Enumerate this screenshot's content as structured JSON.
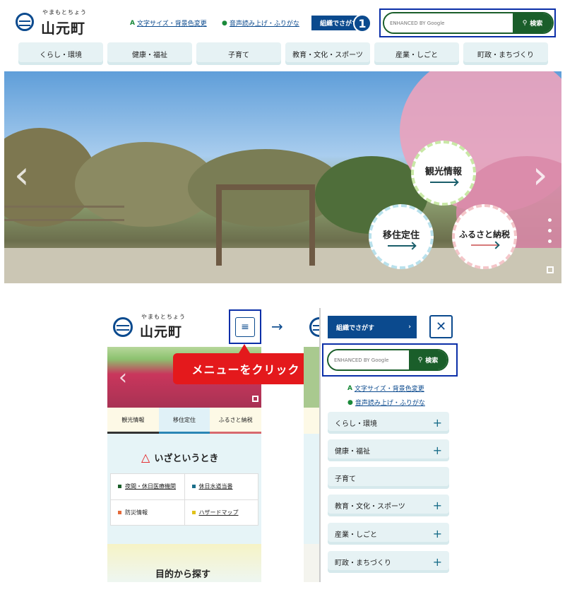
{
  "header": {
    "logo_ruby": "やまもとちょう",
    "logo_name": "山元町",
    "font_size_link": "文字サイズ・背景色変更",
    "font_size_icon": "A",
    "speech_link": "音声読み上げ・ふりがな",
    "org_button": "組織でさがす",
    "badge_number": "1",
    "search_placeholder": "ENHANCED BY Google",
    "search_button": "検索"
  },
  "global_nav": [
    "くらし・環境",
    "健康・福祉",
    "子育て",
    "教育・文化・スポーツ",
    "産業・しごと",
    "町政・まちづくり"
  ],
  "hero": {
    "buttons": [
      "観光情報",
      "移住定住",
      "ふるさと納税"
    ],
    "prev_arrow": "‹",
    "next_arrow": "›"
  },
  "mobile_left": {
    "logo_ruby": "やまもとちょう",
    "logo_name": "山元町",
    "callout": "メニューをクリック",
    "tabs": [
      "観光情報",
      "移住定住",
      "ふるさと納税"
    ],
    "emergency_title": "いざというとき",
    "emergency_items": [
      "夜間・休日医療機関",
      "休日水道当番",
      "防災情報",
      "ハザードマップ"
    ],
    "purpose_title": "目的から探す"
  },
  "transition_arrow": "→",
  "mobile_right": {
    "org_button": "組織でさがす",
    "org_arrow": "›",
    "close_icon": "✕",
    "search_placeholder": "ENHANCED BY Google",
    "search_button": "検索",
    "font_size_link": "文字サイズ・背景色変更",
    "speech_link": "音声読み上げ・ふりがな",
    "menu_items": [
      "くらし・環境",
      "健康・福祉",
      "子育て",
      "教育・文化・スポーツ",
      "産業・しごと",
      "町政・まちづくり"
    ]
  },
  "colors": {
    "brand_blue": "#0b4a8e",
    "search_green": "#1a5e2a",
    "nav_bg": "#e6f2f4",
    "callout_red": "#e4191c",
    "highlight_border": "#0b2fa8"
  }
}
